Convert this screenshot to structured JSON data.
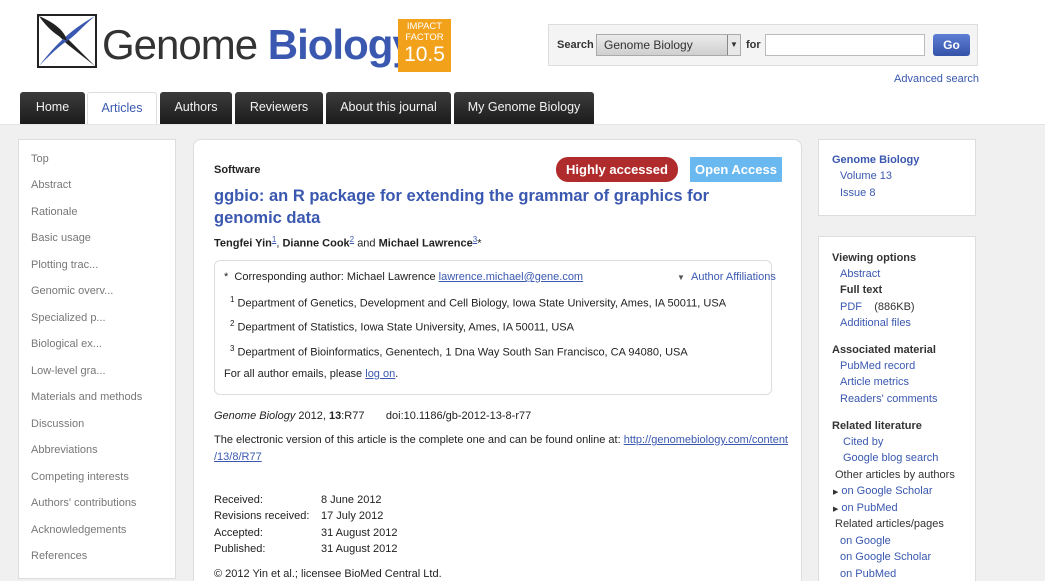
{
  "brand": {
    "word1": "Genome",
    "word2": "Biology",
    "impact_line1": "IMPACT",
    "impact_line2": "FACTOR",
    "impact_value": "10.5"
  },
  "search": {
    "label": "Search",
    "selected": "Genome Biology",
    "for_label": "for",
    "go_label": "Go",
    "advanced": "Advanced search"
  },
  "nav": {
    "tabs": [
      "Home",
      "Articles",
      "Authors",
      "Reviewers",
      "About this journal",
      "My Genome Biology"
    ],
    "active": "Articles"
  },
  "left_sidebar": {
    "items": [
      "Top",
      "Abstract",
      "Rationale",
      "Basic usage",
      "Plotting trac...",
      "Genomic overv...",
      "Specialized p...",
      "Biological ex...",
      "Low-level gra...",
      "Materials and methods",
      "Discussion",
      "Abbreviations",
      "Competing interests",
      "Authors' contributions",
      "Acknowledgements",
      "References"
    ]
  },
  "article": {
    "section": "Software",
    "badge_highly": "Highly accessed",
    "badge_open": "Open Access",
    "title": "ggbio: an R package for extending the grammar of graphics for genomic data",
    "authors": [
      {
        "name": "Tengfei Yin",
        "sup": "1"
      },
      {
        "name": "Dianne Cook",
        "sup": "2"
      },
      {
        "name": "Michael Lawrence",
        "sup": "3"
      }
    ],
    "authors_and": "and",
    "corresponding_label": "Corresponding author: Michael Lawrence",
    "corresponding_email": "lawrence.michael@gene.com",
    "affiliations_toggle": "Author Affiliations",
    "affiliations": [
      {
        "num": "1",
        "text": "Department of Genetics, Development and Cell Biology, Iowa State University, Ames, IA 50011, USA"
      },
      {
        "num": "2",
        "text": "Department of Statistics, Iowa State University, Ames, IA 50011, USA"
      },
      {
        "num": "3",
        "text": "Department of Bioinformatics, Genentech, 1 Dna Way South San Francisco, CA 94080, USA"
      }
    ],
    "emails_prefix": "For all author emails, please",
    "emails_link": "log on",
    "citation_journal": "Genome Biology",
    "citation_year": "2012,",
    "citation_volume": "13",
    "citation_article": ":R77",
    "doi": "doi:10.1186/gb-2012-13-8-r77",
    "electronic_text": "The electronic version of this article is the complete one and can be found online at:",
    "electronic_url_1": "http://genomebiology.com/content",
    "electronic_url_2": "/13/8/R77",
    "history": [
      {
        "label": "Received:",
        "date": "8 June 2012"
      },
      {
        "label": "Revisions received:",
        "date": "17 July 2012"
      },
      {
        "label": "Accepted:",
        "date": "31 August 2012"
      },
      {
        "label": "Published:",
        "date": "31 August 2012"
      }
    ],
    "copyright": "© 2012 Yin et al.; licensee BioMed Central Ltd."
  },
  "right_sidebar": {
    "journal": {
      "title": "Genome Biology",
      "volume": "Volume 13",
      "issue": "Issue 8"
    },
    "viewing": {
      "heading": "Viewing options",
      "abstract": "Abstract",
      "full_text": "Full text",
      "pdf": "PDF",
      "pdf_size": "(886KB)",
      "additional": "Additional files"
    },
    "associated": {
      "heading": "Associated material",
      "pubmed_record": "PubMed record",
      "metrics": "Article metrics",
      "comments": "Readers' comments"
    },
    "related": {
      "heading": "Related literature",
      "cited_by": "Cited by",
      "blog": "Google blog search",
      "other_by_authors": "Other articles by authors",
      "on_scholar": "on Google Scholar",
      "on_pubmed": "on PubMed",
      "related_pages": "Related articles/pages",
      "on_google": "on Google",
      "on_scholar2": "on Google Scholar",
      "on_pubmed2": "on PubMed"
    }
  },
  "colors": {
    "brand_blue": "#3a58b0",
    "impact_orange": "#f2a11b",
    "highly_red": "#b02b2b",
    "open_blue": "#69b8f0",
    "nav_dark": "#2a2a2a"
  }
}
